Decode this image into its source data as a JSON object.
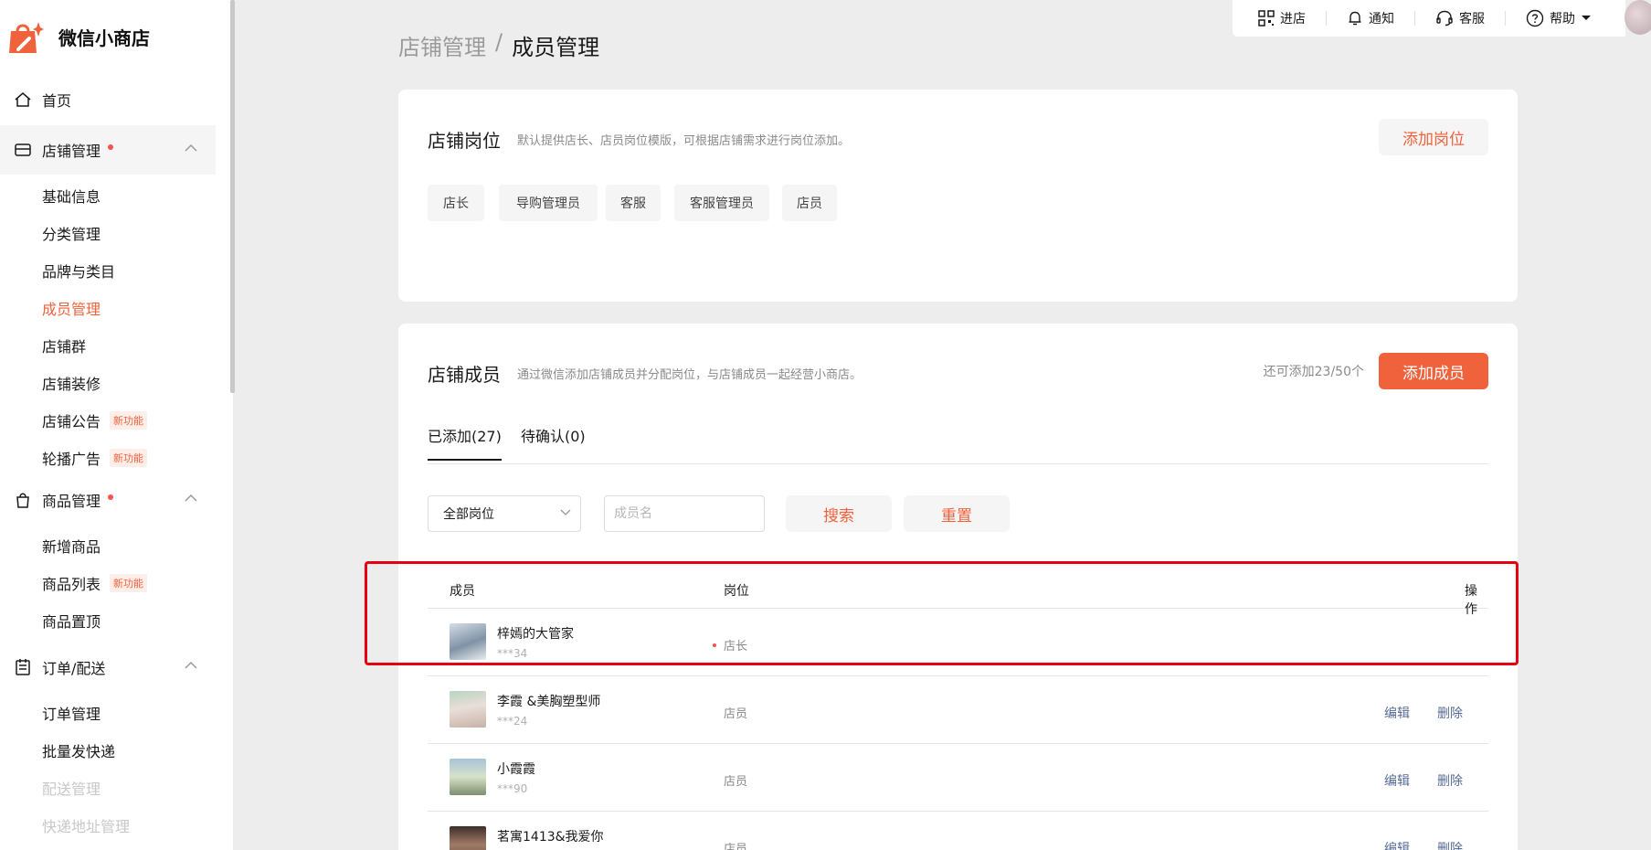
{
  "app": {
    "name": "微信小商店"
  },
  "sidebar": {
    "home": "首页",
    "groups": [
      {
        "label": "店铺管理",
        "items": [
          "基础信息",
          "分类管理",
          "品牌与类目",
          "成员管理",
          "店铺群",
          "店铺装修",
          "店铺公告",
          "轮播广告"
        ]
      },
      {
        "label": "商品管理",
        "items": [
          "新增商品",
          "商品列表",
          "商品置顶"
        ]
      },
      {
        "label": "订单/配送",
        "items": [
          "订单管理",
          "批量发快递",
          "配送管理",
          "快递地址管理"
        ]
      }
    ],
    "new_badge": "新功能"
  },
  "topbar": {
    "enter_store": "进店",
    "notify": "通知",
    "service": "客服",
    "help": "帮助"
  },
  "breadcrumb": {
    "parent": "店铺管理",
    "sep": "/",
    "current": "成员管理"
  },
  "positions_card": {
    "title": "店铺岗位",
    "desc": "默认提供店长、店员岗位模版，可根据店铺需求进行岗位添加。",
    "add_button": "添加岗位",
    "tags": [
      "店长",
      "导购管理员",
      "客服",
      "客服管理员",
      "店员"
    ]
  },
  "members_card": {
    "title": "店铺成员",
    "desc": "通过微信添加店铺成员并分配岗位，与店铺成员一起经营小商店。",
    "quota": "还可添加23/50个",
    "add_button": "添加成员",
    "tabs": [
      "已添加(27)",
      "待确认(0)"
    ],
    "filter": {
      "select_value": "全部岗位",
      "name_placeholder": "成员名",
      "search": "搜索",
      "reset": "重置"
    },
    "columns": {
      "member": "成员",
      "role": "岗位",
      "ops": "操作"
    },
    "edit": "编辑",
    "delete": "删除",
    "rows": [
      {
        "name": "梓嫣的大管家",
        "id": "***34",
        "role": "店长"
      },
      {
        "name": "李霞 &美胸塑型师",
        "id": "***24",
        "role": "店员"
      },
      {
        "name": "小霞霞",
        "id": "***90",
        "role": "店员"
      },
      {
        "name": "茗寓1413&我爱你",
        "id": "",
        "role": "店员"
      }
    ]
  },
  "colors": {
    "accent": "#f0623c",
    "link": "#576b95",
    "highlight": "#e60012"
  }
}
